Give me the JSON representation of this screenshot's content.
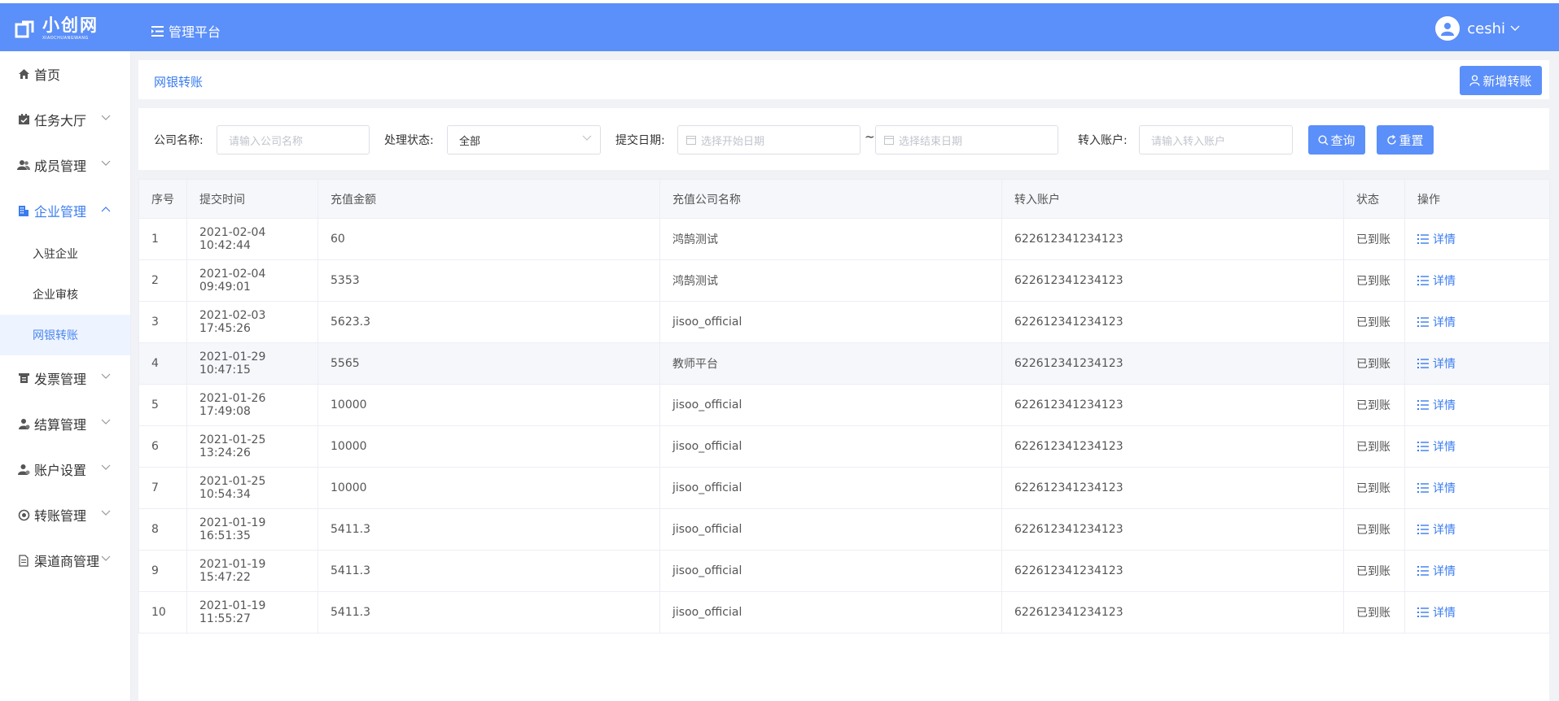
{
  "header": {
    "logo_cn": "小创网",
    "logo_en": "XIAOCHUANGWANG",
    "platform_label": "管理平台",
    "username": "ceshi"
  },
  "sidebar": {
    "items": [
      {
        "label": "首页",
        "icon": "home-icon"
      },
      {
        "label": "任务大厅",
        "icon": "task-icon"
      },
      {
        "label": "成员管理",
        "icon": "members-icon"
      },
      {
        "label": "企业管理",
        "icon": "building-icon"
      },
      {
        "label": "发票管理",
        "icon": "invoice-icon"
      },
      {
        "label": "结算管理",
        "icon": "settlement-icon"
      },
      {
        "label": "账户设置",
        "icon": "account-icon"
      },
      {
        "label": "转账管理",
        "icon": "transfer-icon"
      },
      {
        "label": "渠道商管理",
        "icon": "channel-icon"
      }
    ],
    "subitems": [
      {
        "label": "入驻企业"
      },
      {
        "label": "企业审核"
      },
      {
        "label": "网银转账"
      }
    ]
  },
  "breadcrumb": {
    "current": "网银转账"
  },
  "add_button": {
    "label": "新增转账"
  },
  "filters": {
    "company_label": "公司名称:",
    "company_placeholder": "请输入公司名称",
    "status_label": "处理状态:",
    "status_value": "全部",
    "date_label": "提交日期:",
    "date_start_placeholder": "选择开始日期",
    "date_sep": "~",
    "date_end_placeholder": "选择结束日期",
    "account_label": "转入账户:",
    "account_placeholder": "请输入转入账户",
    "search_label": "查询",
    "reset_label": "重置"
  },
  "table": {
    "columns": [
      "序号",
      "提交时间",
      "充值金额",
      "充值公司名称",
      "转入账户",
      "状态",
      "操作"
    ],
    "detail_label": "详情",
    "rows": [
      {
        "no": "1",
        "time": "2021-02-04 10:42:44",
        "amount": "60",
        "company": "鸿鹄测试",
        "account": "622612341234123",
        "status": "已到账"
      },
      {
        "no": "2",
        "time": "2021-02-04 09:49:01",
        "amount": "5353",
        "company": "鸿鹄测试",
        "account": "622612341234123",
        "status": "已到账"
      },
      {
        "no": "3",
        "time": "2021-02-03 17:45:26",
        "amount": "5623.3",
        "company": "jisoo_official",
        "account": "622612341234123",
        "status": "已到账"
      },
      {
        "no": "4",
        "time": "2021-01-29 10:47:15",
        "amount": "5565",
        "company": "教师平台",
        "account": "622612341234123",
        "status": "已到账"
      },
      {
        "no": "5",
        "time": "2021-01-26 17:49:08",
        "amount": "10000",
        "company": "jisoo_official",
        "account": "622612341234123",
        "status": "已到账"
      },
      {
        "no": "6",
        "time": "2021-01-25 13:24:26",
        "amount": "10000",
        "company": "jisoo_official",
        "account": "622612341234123",
        "status": "已到账"
      },
      {
        "no": "7",
        "time": "2021-01-25 10:54:34",
        "amount": "10000",
        "company": "jisoo_official",
        "account": "622612341234123",
        "status": "已到账"
      },
      {
        "no": "8",
        "time": "2021-01-19 16:51:35",
        "amount": "5411.3",
        "company": "jisoo_official",
        "account": "622612341234123",
        "status": "已到账"
      },
      {
        "no": "9",
        "time": "2021-01-19 15:47:22",
        "amount": "5411.3",
        "company": "jisoo_official",
        "account": "622612341234123",
        "status": "已到账"
      },
      {
        "no": "10",
        "time": "2021-01-19 11:55:27",
        "amount": "5411.3",
        "company": "jisoo_official",
        "account": "622612341234123",
        "status": "已到账"
      }
    ]
  },
  "colors": {
    "primary": "#5b8ff9",
    "active": "#3a7cf0",
    "bg": "#f0f2f5"
  }
}
